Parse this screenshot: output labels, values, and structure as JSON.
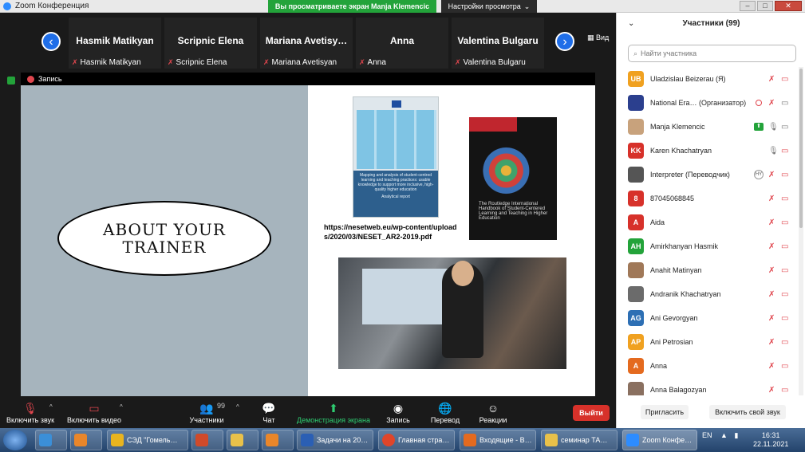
{
  "window": {
    "title": "Zoom Конференция",
    "share_banner": "Вы просматриваете экран Manja Klemencic",
    "view_settings": "Настройки просмотра",
    "view_label": "Вид"
  },
  "gallery": {
    "tiles": [
      {
        "big": "Hasmik Matikyan",
        "small": "Hasmik Matikyan"
      },
      {
        "big": "Scripnic Elena",
        "small": "Scripnic Elena"
      },
      {
        "big": "Mariana  Avetisy…",
        "small": "Mariana Avetisyan"
      },
      {
        "big": "Anna",
        "small": "Anna"
      },
      {
        "big": "Valentina Bulgaru",
        "small": "Valentina Bulgaru"
      }
    ]
  },
  "share": {
    "recording_label": "Запись",
    "slide_heading": "ABOUT YOUR TRAINER",
    "book1_text": "Mapping and analysis of student-centred learning and teaching practices: usable knowledge to support more inclusive, high-quality higher education",
    "book1_sub": "Analytical report",
    "book2_text": "The Routledge International Handbook of Student-Centered Learning and Teaching in Higher Education",
    "url": "https://nesetweb.eu/wp-content/uploads/2020/03/NESET_AR2-2019.pdf"
  },
  "toolbar": {
    "audio": "Включить звук",
    "video": "Включить видео",
    "participants": "Участники",
    "participants_count": "99",
    "chat": "Чат",
    "share": "Демонстрация экрана",
    "record": "Запись",
    "translate": "Перевод",
    "reactions": "Реакции",
    "leave": "Выйти"
  },
  "panel": {
    "title": "Участники (99)",
    "search_placeholder": "Найти участника",
    "participants": [
      {
        "initials": "UB",
        "color": "#f0a120",
        "name": "Uladzislau  Beizerau (Я)"
      },
      {
        "initials": "",
        "color": "#2b3f8e",
        "name": "National Era… (Организатор)"
      },
      {
        "initials": "",
        "color": "#c8a27c",
        "name": "Manja Klemencic"
      },
      {
        "initials": "KK",
        "color": "#d7312a",
        "name": "Karen Khachatryan"
      },
      {
        "initials": "",
        "color": "#555555",
        "name": "Interpreter (Переводчик)"
      },
      {
        "initials": "8",
        "color": "#d7312a",
        "name": "87045068845"
      },
      {
        "initials": "A",
        "color": "#d7312a",
        "name": "Aida"
      },
      {
        "initials": "AH",
        "color": "#23a33a",
        "name": "Amirkhanyan Hasmik"
      },
      {
        "initials": "",
        "color": "#a07858",
        "name": "Anahit Matinyan"
      },
      {
        "initials": "",
        "color": "#6b6b6b",
        "name": "Andranik Khachatryan"
      },
      {
        "initials": "AG",
        "color": "#2d6fb4",
        "name": "Ani Gevorgyan"
      },
      {
        "initials": "AP",
        "color": "#f0a120",
        "name": "Ani Petrosian"
      },
      {
        "initials": "A",
        "color": "#e46a1f",
        "name": "Anna"
      },
      {
        "initials": "",
        "color": "#8a7060",
        "name": "Anna Balagozyan"
      }
    ],
    "interpreter_badge": "HY",
    "invite": "Пригласить",
    "unmute_me": "Включить свой звук"
  },
  "taskbar": {
    "items": [
      {
        "label": "СЭД \"Гомель…",
        "color": "#e9b41e"
      },
      {
        "label": "",
        "color": "#d04a2a"
      },
      {
        "label": "",
        "color": "#e9c14a"
      },
      {
        "label": "",
        "color": "#e9862a"
      },
      {
        "label": "Задачи на 20…",
        "color": "#2b5fb4"
      },
      {
        "label": "Главная стра…",
        "color": "#e0452a"
      },
      {
        "label": "Входящие - В…",
        "color": "#e46a1f"
      },
      {
        "label": "семинар ТА…",
        "color": "#e9c14a"
      },
      {
        "label": "Zoom Конфе…",
        "color": "#2d8cff"
      }
    ],
    "lang": "EN",
    "time": "16:31",
    "date": "22.11.2021"
  }
}
